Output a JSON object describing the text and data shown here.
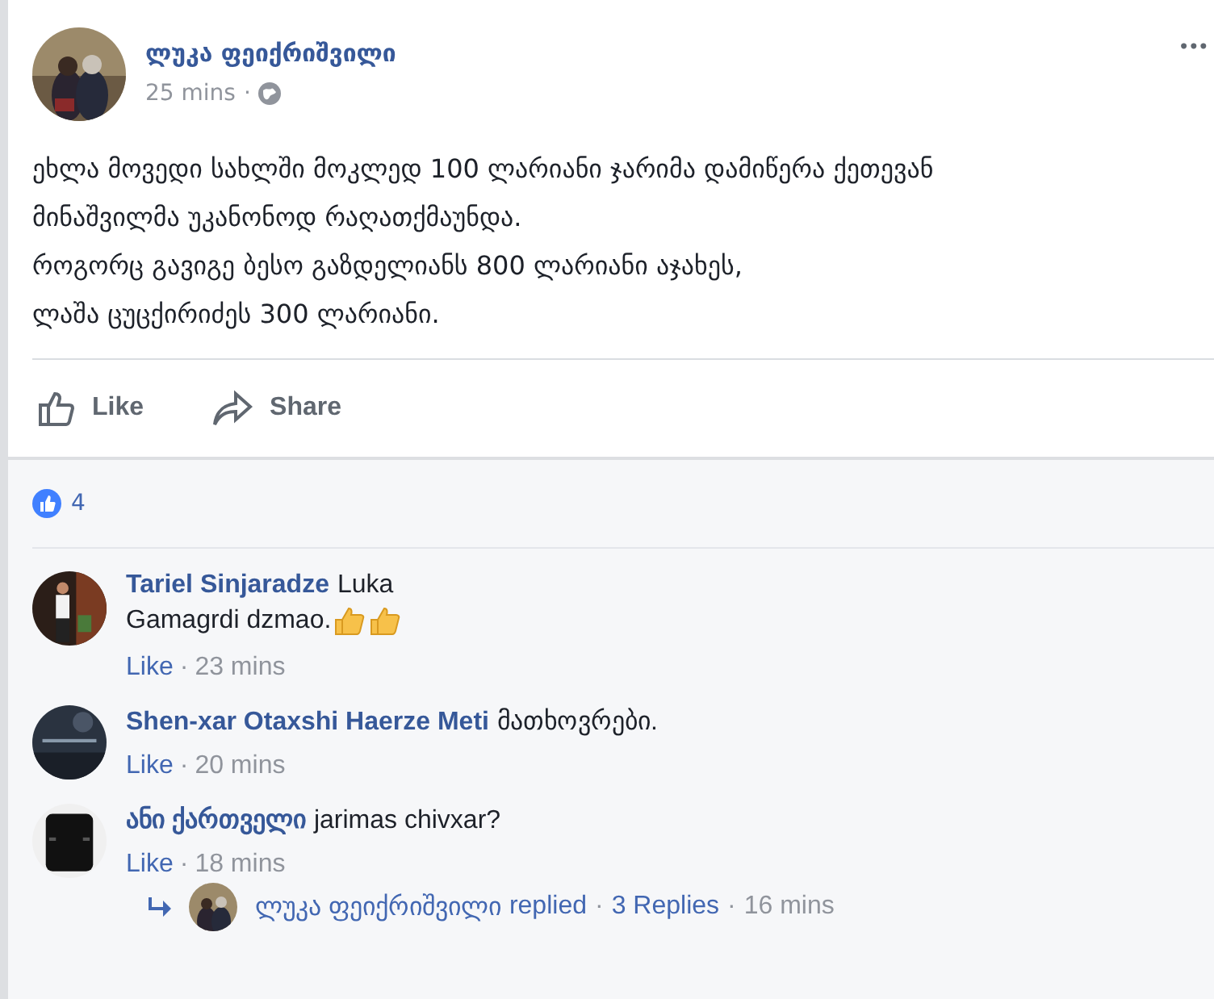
{
  "post": {
    "author": "ლუკა ფეიქრიშვილი",
    "time": "25 mins",
    "separator": "·",
    "menu": "•••",
    "lines": [
      "ეხლა მოვედი სახლში მოკლედ 100 ლარიანი ჯარიმა დამიწერა ქეთევან",
      "მინაშვილმა უკანონოდ რაღათქმაუნდა.",
      "როგორც გავიგე ბესო გაზდელიანს 800 ლარიანი აჯახეს,",
      "ლაშა ცუცქირიძეს 300 ლარიანი."
    ]
  },
  "actions": [
    {
      "kind": "like",
      "label": "Like"
    },
    {
      "kind": "share",
      "label": "Share"
    }
  ],
  "reactions": {
    "count": "4"
  },
  "comments": [
    {
      "author": "Tariel Sinjaradze",
      "text": "Luka",
      "line2": "Gamagrdi dzmao.",
      "emoji": [
        {
          "kind": "thumbs-up"
        },
        {
          "kind": "thumbs-up"
        }
      ],
      "like": "Like",
      "separator": "·",
      "time": "23 mins"
    },
    {
      "author": "Shen-xar Otaxshi Haerze Meti",
      "text": "მათხოვრები.",
      "like": "Like",
      "separator": "·",
      "time": "20 mins"
    },
    {
      "author": "ანი ქართველი",
      "text": "jarimas chivxar?",
      "like": "Like",
      "separator": "·",
      "time": "18 mins"
    }
  ],
  "replies": {
    "author": "ლუკა ფეიქრიშვილი",
    "replied": "replied",
    "separator_1": "·",
    "count": "3 Replies",
    "separator_2": "·",
    "time": "16 mins"
  }
}
